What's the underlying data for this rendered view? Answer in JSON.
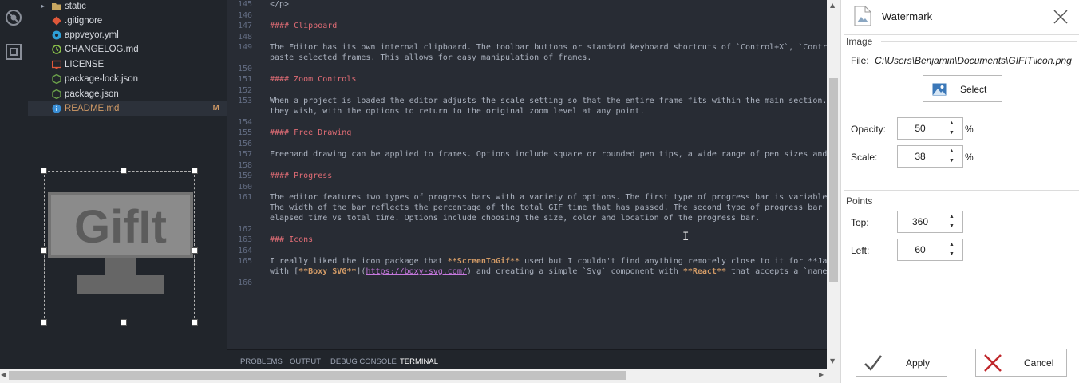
{
  "explorer": {
    "items": [
      {
        "label": "static",
        "icon": "folder-icon",
        "caret": "▸"
      },
      {
        "label": ".gitignore",
        "icon": "git-icon"
      },
      {
        "label": "appveyor.yml",
        "icon": "appveyor-icon"
      },
      {
        "label": "CHANGELOG.md",
        "icon": "changelog-icon"
      },
      {
        "label": "LICENSE",
        "icon": "license-icon"
      },
      {
        "label": "package-lock.json",
        "icon": "npm-icon"
      },
      {
        "label": "package.json",
        "icon": "npm-icon"
      },
      {
        "label": "README.md",
        "icon": "info-icon",
        "badge": "M"
      }
    ]
  },
  "editor": {
    "lines": [
      {
        "n": "145",
        "text": "</p>"
      },
      {
        "n": "146",
        "text": ""
      },
      {
        "n": "147",
        "text": "#### Clipboard"
      },
      {
        "n": "148",
        "text": ""
      },
      {
        "n": "149",
        "text": "The Editor has its own internal clipboard. The toolbar buttons or standard keyboard shortcuts of `Control+X`, `Contro"
      },
      {
        "n": "",
        "text": "paste selected frames. This allows for easy manipulation of frames."
      },
      {
        "n": "150",
        "text": ""
      },
      {
        "n": "151",
        "text": "#### Zoom Controls"
      },
      {
        "n": "152",
        "text": ""
      },
      {
        "n": "153",
        "text": "When a project is loaded the editor adjusts the scale setting so that the entire frame fits within the main section."
      },
      {
        "n": "",
        "text": "they wish, with the options to return to the original zoom level at any point."
      },
      {
        "n": "154",
        "text": ""
      },
      {
        "n": "155",
        "text": "#### Free Drawing"
      },
      {
        "n": "156",
        "text": ""
      },
      {
        "n": "157",
        "text": "Freehand drawing can be applied to frames. Options include square or rounded pen tips, a wide range of pen sizes and"
      },
      {
        "n": "158",
        "text": ""
      },
      {
        "n": "159",
        "text": "#### Progress"
      },
      {
        "n": "160",
        "text": ""
      },
      {
        "n": "161",
        "text": "The editor features two types of progress bars with a variety of options. The first type of progress bar is variable"
      },
      {
        "n": "",
        "text": "The width of the bar reflects the percentage of the total GIF time that has passed. The second type of progress bar i"
      },
      {
        "n": "",
        "text": "elapsed time vs total time. Options include choosing the size, color and location of the progress bar."
      },
      {
        "n": "162",
        "text": ""
      },
      {
        "n": "163",
        "text": "### Icons"
      },
      {
        "n": "164",
        "text": ""
      },
      {
        "n": "165",
        "text": "I really liked the icon package that **ScreenToGif** used but I couldn't find anything remotely close to it for **Jav"
      },
      {
        "n": "",
        "text": "with [**Boxy SVG**](https://boxy-svg.com/) and creating a simple `Svg` component with **React** that accepts a `name"
      },
      {
        "n": "166",
        "text": ""
      }
    ]
  },
  "panel_tabs": [
    {
      "label": "PROBLEMS",
      "active": false
    },
    {
      "label": "OUTPUT",
      "active": false
    },
    {
      "label": "DEBUG CONSOLE",
      "active": false
    },
    {
      "label": "TERMINAL",
      "active": true
    }
  ],
  "watermark_graphic": {
    "text": "GifIt"
  },
  "side_panel": {
    "title": "Watermark",
    "image_section": "Image",
    "file_label": "File:",
    "file_path": "C:\\Users\\Benjamin\\Documents\\GIFIT\\icon.png",
    "select_label": "Select",
    "opacity_label": "Opacity:",
    "opacity_value": "50",
    "opacity_unit": "%",
    "scale_label": "Scale:",
    "scale_value": "38",
    "scale_unit": "%",
    "points_section": "Points",
    "top_label": "Top:",
    "top_value": "360",
    "left_label": "Left:",
    "left_value": "60",
    "apply_label": "Apply",
    "cancel_label": "Cancel"
  },
  "colors": {
    "editor_bg": "#282c34",
    "sidebar_bg": "#21252b",
    "heading": "#e06c75",
    "bold": "#d19a66",
    "apply_check": "#555555",
    "cancel_x": "#c0282d"
  }
}
